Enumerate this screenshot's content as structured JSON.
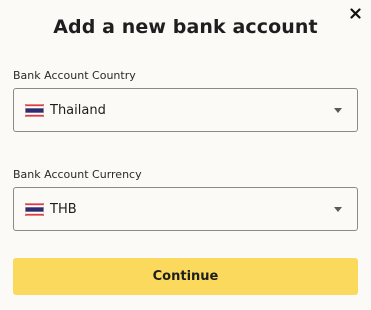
{
  "dialog": {
    "title": "Add a new bank account",
    "close_icon": "close-icon"
  },
  "country": {
    "label": "Bank Account Country",
    "value": "Thailand",
    "flag_icon": "thailand-flag-icon",
    "caret_icon": "caret-down-icon"
  },
  "currency": {
    "label": "Bank Account Currency",
    "value": "THB",
    "flag_icon": "thailand-flag-icon",
    "caret_icon": "caret-down-icon"
  },
  "actions": {
    "continue_label": "Continue"
  },
  "colors": {
    "background": "#fcfaf6",
    "primary_button": "#fad95c",
    "border": "#8c8a86",
    "text": "#1e1e1e"
  }
}
